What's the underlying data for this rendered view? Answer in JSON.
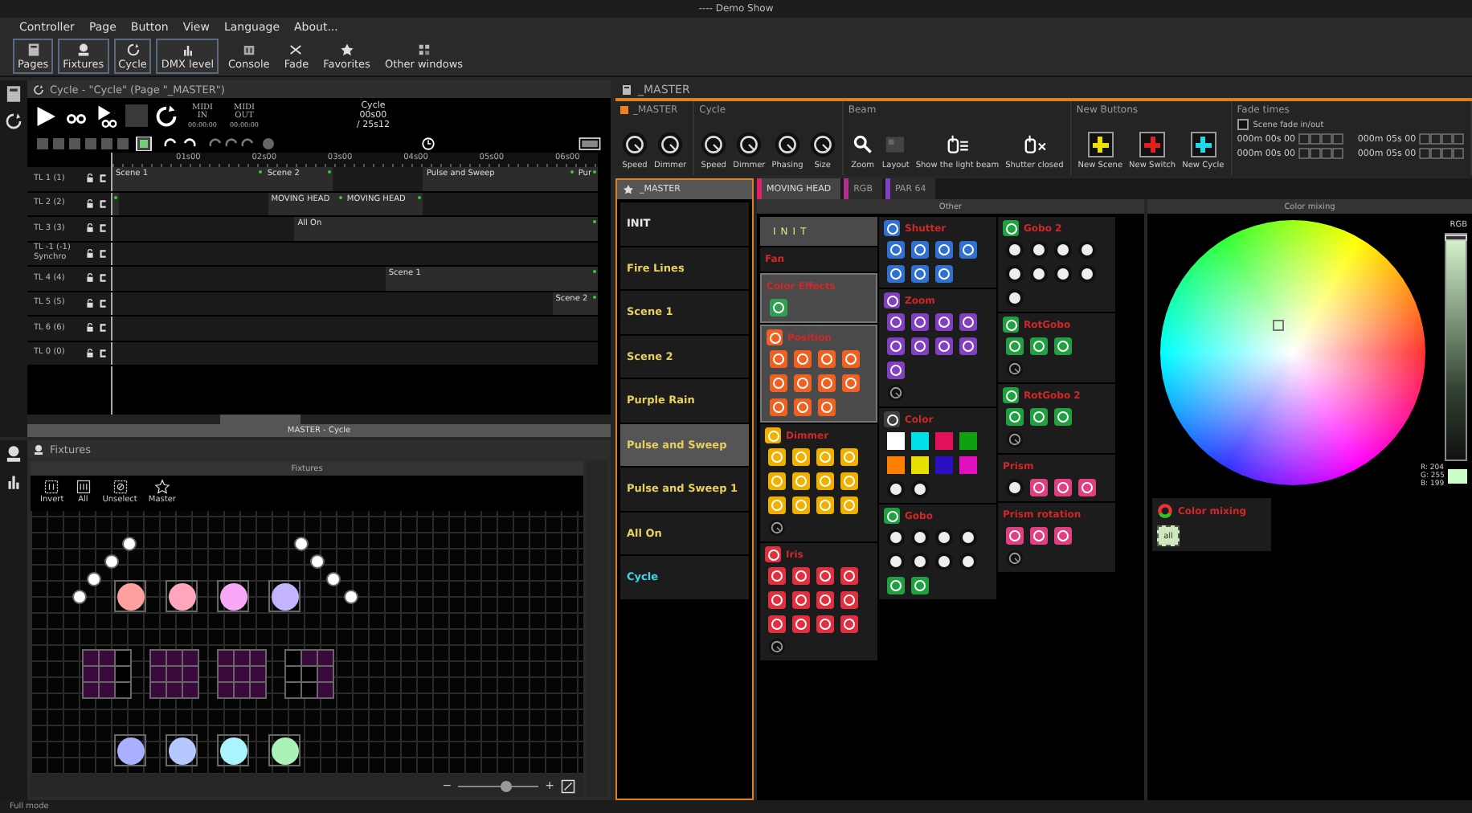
{
  "window": {
    "title": "---- Demo Show"
  },
  "menu": [
    "Controller",
    "Page",
    "Button",
    "View",
    "Language",
    "About..."
  ],
  "toolbar": [
    {
      "label": "Pages",
      "kind": "pages",
      "on": true
    },
    {
      "label": "Fixtures",
      "kind": "fixtures",
      "on": true
    },
    {
      "label": "Cycle",
      "kind": "cycle",
      "on": true
    },
    {
      "label": "DMX level",
      "kind": "levels",
      "on": true
    },
    {
      "label": "Console",
      "kind": "console",
      "on": false
    },
    {
      "label": "Fade",
      "kind": "fade",
      "on": false
    },
    {
      "label": "Favorites",
      "kind": "favorites",
      "on": false
    },
    {
      "label": "Other windows",
      "kind": "windows",
      "on": false
    }
  ],
  "cycle_window": {
    "title": "Cycle - \"Cycle\" (Page \"_MASTER\")",
    "midi": [
      {
        "label": "MIDI IN",
        "time": "00:00:00"
      },
      {
        "label": "MIDI OUT",
        "time": "00:00:00"
      }
    ],
    "clock": {
      "label": "Cycle",
      "time": "00s00",
      "total": "/ 25s12"
    },
    "ruler": [
      "01s00",
      "02s00",
      "03s00",
      "04s00",
      "05s00",
      "06s00"
    ],
    "tracks": [
      {
        "label": "TL 1 (1)",
        "clips": [
          {
            "kind": "clip",
            "label": "Scene 1"
          },
          {
            "kind": "clip",
            "label": "Scene 2"
          },
          {
            "kind": "clip",
            "label": "Pulse and Sweep"
          },
          {
            "kind": "clip",
            "label": "Pur"
          }
        ]
      },
      {
        "label": "TL 2 (2)",
        "clips": [
          {
            "kind": "start"
          },
          {
            "kind": "clip",
            "label": "MOVING HEAD"
          },
          {
            "kind": "clip",
            "label": "MOVING HEAD"
          }
        ]
      },
      {
        "label": "TL 3 (3)",
        "clips": [
          {
            "kind": "clip",
            "label": "All On"
          }
        ]
      },
      {
        "label": "TL -1 (-1) Synchro"
      },
      {
        "label": "TL 4 (4)",
        "clips": [
          {
            "kind": "clip",
            "label": "Scene 1"
          }
        ]
      },
      {
        "label": "TL 5 (5)",
        "clips": [
          {
            "kind": "clip",
            "label": "Scene 2"
          }
        ]
      },
      {
        "label": "TL 6 (6)"
      },
      {
        "label": "TL 0 (0)"
      }
    ],
    "footer": "MASTER - Cycle"
  },
  "fixtures_window": {
    "title": "Fixtures",
    "panel_title": "Fixtures",
    "tools": [
      {
        "label": "Invert",
        "kind": "invert"
      },
      {
        "label": "All",
        "kind": "all"
      },
      {
        "label": "Unselect",
        "kind": "unselect"
      },
      {
        "label": "Master",
        "kind": "master"
      }
    ],
    "lamps": [
      {
        "color": "#ffa0a0"
      },
      {
        "color": "#ffa6bd"
      },
      {
        "color": "#f7a9f7"
      },
      {
        "color": "#c4b3ff"
      },
      {
        "color": "#aab0ff"
      },
      {
        "color": "#b4c8ff"
      },
      {
        "color": "#aaf4ff"
      },
      {
        "color": "#aaf2b8"
      }
    ],
    "matrices": [
      {
        "cells": [
          true,
          true,
          false,
          true,
          true,
          false,
          true,
          true,
          false
        ]
      },
      {
        "cells": [
          true,
          true,
          true,
          true,
          true,
          true,
          true,
          true,
          true
        ]
      },
      {
        "cells": [
          true,
          true,
          true,
          true,
          true,
          true,
          true,
          true,
          true
        ]
      },
      {
        "cells": [
          false,
          true,
          true,
          false,
          false,
          true,
          false,
          false,
          true
        ]
      }
    ],
    "zoom": {
      "minus": "−",
      "plus": "+",
      "level": 0.6
    }
  },
  "master_window": {
    "title": "_MASTER",
    "groups": [
      {
        "title": "_MASTER",
        "controls": [
          {
            "kind": "knob",
            "label": "Speed"
          },
          {
            "kind": "knob",
            "label": "Dimmer"
          }
        ]
      },
      {
        "title": "Cycle",
        "controls": [
          {
            "kind": "knob",
            "label": "Speed"
          },
          {
            "kind": "knob",
            "label": "Dimmer"
          },
          {
            "kind": "knob",
            "label": "Phasing"
          },
          {
            "kind": "knob",
            "label": "Size"
          }
        ]
      },
      {
        "title": "Beam",
        "controls": [
          {
            "kind": "zoom",
            "label": "Zoom"
          },
          {
            "kind": "layout",
            "label": "Layout"
          },
          {
            "kind": "beam",
            "label": "Show the light beam"
          },
          {
            "kind": "shutter",
            "label": "Shutter closed"
          }
        ]
      },
      {
        "title": "New Buttons",
        "controls": [
          {
            "kind": "add",
            "label": "New Scene",
            "color": "#f0e000"
          },
          {
            "kind": "add",
            "label": "New Switch",
            "color": "#e02020"
          },
          {
            "kind": "add",
            "label": "New Cycle",
            "color": "#20d8e8"
          }
        ]
      }
    ],
    "fade_times": {
      "title": "Fade times",
      "checkbox": {
        "label": "Scene fade in/out",
        "checked": false
      },
      "times": [
        "000m 00s 00",
        "000m 05s 00",
        "000m 00s 00",
        "000m 05s 00"
      ]
    },
    "pages": {
      "tab": "_MASTER",
      "items": [
        {
          "label": "INIT",
          "color": "#e8e8e8",
          "selected": false
        },
        {
          "label": "Fire Lines",
          "color": "#e8d060",
          "selected": false
        },
        {
          "label": "Scene 1",
          "color": "#e8d060",
          "selected": false
        },
        {
          "label": "Scene 2",
          "color": "#e8d060",
          "selected": false
        },
        {
          "label": "Purple Rain",
          "color": "#e8d060",
          "selected": false
        },
        {
          "label": "Pulse and Sweep",
          "color": "#e8d060",
          "selected": true
        },
        {
          "label": "Pulse and Sweep 1",
          "color": "#e8d060",
          "selected": false
        },
        {
          "label": "All On",
          "color": "#e8d060",
          "selected": false
        },
        {
          "label": "Cycle",
          "color": "#40d8e8",
          "selected": false
        }
      ]
    },
    "fixture_tabs": [
      {
        "label": "MOVING HEAD",
        "color": "#e0206a",
        "selected": true
      },
      {
        "label": "RGB",
        "color": "#b03090",
        "selected": false
      },
      {
        "label": "PAR 64",
        "color": "#8040c0",
        "selected": false
      }
    ],
    "other": {
      "title": "Other",
      "columns": [
        [
          {
            "kind": "banner",
            "title": "INIT"
          },
          {
            "kind": "group",
            "title": "Fan",
            "selected": false,
            "icon": false
          },
          {
            "kind": "group",
            "title": "Color Effects",
            "selected": true,
            "icon": false,
            "color": "#30a050",
            "presets": [
              {
                "kind": "tile"
              }
            ]
          },
          {
            "kind": "group",
            "title": "Position",
            "selected": true,
            "icon": true,
            "color": "#f06020",
            "presets": [
              {
                "kind": "tile"
              },
              {
                "kind": "tile"
              },
              {
                "kind": "tile"
              },
              {
                "kind": "tile"
              },
              {
                "kind": "tile"
              },
              {
                "kind": "tile"
              },
              {
                "kind": "tile"
              },
              {
                "kind": "tile"
              },
              {
                "kind": "tile"
              },
              {
                "kind": "tile"
              },
              {
                "kind": "tile"
              }
            ]
          },
          {
            "kind": "group",
            "title": "Dimmer",
            "selected": false,
            "icon": true,
            "color": "#f0b000",
            "presets": [
              {
                "kind": "tile"
              },
              {
                "kind": "tile"
              },
              {
                "kind": "tile"
              },
              {
                "kind": "tile"
              },
              {
                "kind": "tile"
              },
              {
                "kind": "tile"
              },
              {
                "kind": "tile"
              },
              {
                "kind": "tile"
              },
              {
                "kind": "tile"
              },
              {
                "kind": "tile"
              },
              {
                "kind": "tile"
              },
              {
                "kind": "tile"
              }
            ],
            "knob": true
          },
          {
            "kind": "group",
            "title": "Iris",
            "selected": false,
            "icon": true,
            "color": "#e03040",
            "presets": [
              {
                "kind": "tile"
              },
              {
                "kind": "tile"
              },
              {
                "kind": "tile"
              },
              {
                "kind": "tile"
              },
              {
                "kind": "tile"
              },
              {
                "kind": "tile"
              },
              {
                "kind": "tile"
              },
              {
                "kind": "tile"
              },
              {
                "kind": "tile"
              },
              {
                "kind": "tile"
              },
              {
                "kind": "tile"
              },
              {
                "kind": "tile"
              }
            ],
            "knob": true
          }
        ],
        [
          {
            "kind": "group",
            "title": "Shutter",
            "selected": false,
            "icon": true,
            "color": "#3070d0",
            "presets": [
              {
                "kind": "tile"
              },
              {
                "kind": "tile"
              },
              {
                "kind": "tile"
              },
              {
                "kind": "tile"
              },
              {
                "kind": "tile"
              },
              {
                "kind": "tile"
              },
              {
                "kind": "tile"
              }
            ]
          },
          {
            "kind": "group",
            "title": "Zoom",
            "selected": false,
            "icon": true,
            "color": "#8040c0",
            "presets": [
              {
                "kind": "tile"
              },
              {
                "kind": "tile"
              },
              {
                "kind": "tile"
              },
              {
                "kind": "tile"
              },
              {
                "kind": "tile"
              },
              {
                "kind": "tile"
              },
              {
                "kind": "tile"
              },
              {
                "kind": "tile"
              },
              {
                "kind": "tile"
              }
            ],
            "knob": true
          },
          {
            "kind": "group",
            "title": "Color",
            "selected": false,
            "icon": true,
            "color": "#404040",
            "presets": [
              {
                "kind": "swatch",
                "color": "#ffffff"
              },
              {
                "kind": "swatch",
                "color": "#00e0e8"
              },
              {
                "kind": "swatch",
                "color": "#e0105a"
              },
              {
                "kind": "swatch",
                "color": "#10a010"
              },
              {
                "kind": "swatch",
                "color": "#ff8000"
              },
              {
                "kind": "swatch",
                "color": "#e8e000"
              },
              {
                "kind": "swatch",
                "color": "#2a10c0"
              },
              {
                "kind": "swatch",
                "color": "#e010c0"
              },
              {
                "kind": "glyph"
              },
              {
                "kind": "glyph"
              }
            ]
          },
          {
            "kind": "group",
            "title": "Gobo",
            "selected": false,
            "icon": true,
            "color": "#20a040",
            "presets": [
              {
                "kind": "glyph"
              },
              {
                "kind": "glyph"
              },
              {
                "kind": "glyph"
              },
              {
                "kind": "glyph"
              },
              {
                "kind": "glyph"
              },
              {
                "kind": "glyph"
              },
              {
                "kind": "glyph"
              },
              {
                "kind": "glyph"
              },
              {
                "kind": "tile"
              },
              {
                "kind": "tile"
              }
            ]
          }
        ],
        [
          {
            "kind": "group",
            "title": "Gobo 2",
            "selected": false,
            "icon": true,
            "color": "#20a040",
            "presets": [
              {
                "kind": "glyph"
              },
              {
                "kind": "glyph"
              },
              {
                "kind": "glyph"
              },
              {
                "kind": "glyph"
              },
              {
                "kind": "glyph"
              },
              {
                "kind": "glyph"
              },
              {
                "kind": "glyph"
              },
              {
                "kind": "glyph"
              },
              {
                "kind": "glyph"
              }
            ]
          },
          {
            "kind": "group",
            "title": "RotGobo",
            "selected": false,
            "icon": true,
            "color": "#20a040",
            "presets": [
              {
                "kind": "tile"
              },
              {
                "kind": "tile"
              },
              {
                "kind": "tile"
              }
            ],
            "knob": true
          },
          {
            "kind": "group",
            "title": "RotGobo 2",
            "selected": false,
            "icon": true,
            "color": "#20a040",
            "presets": [
              {
                "kind": "tile"
              },
              {
                "kind": "tile"
              },
              {
                "kind": "tile"
              }
            ],
            "knob": true
          },
          {
            "kind": "group",
            "title": "Prism",
            "selected": false,
            "icon": false,
            "color": "#e04080",
            "presets": [
              {
                "kind": "glyph"
              },
              {
                "kind": "tile"
              },
              {
                "kind": "tile"
              },
              {
                "kind": "tile"
              }
            ]
          },
          {
            "kind": "group",
            "title": "Prism rotation",
            "selected": false,
            "icon": false,
            "color": "#e04080",
            "presets": [
              {
                "kind": "tile"
              },
              {
                "kind": "tile"
              },
              {
                "kind": "tile"
              }
            ],
            "knob": true
          }
        ]
      ]
    },
    "color_mixing": {
      "title": "Color mixing",
      "slider_label": "RGB",
      "level": 0.97,
      "readings": [
        "R: 204",
        "G: 255",
        "B: 199"
      ],
      "color": "#ccffc7",
      "group": {
        "title": "Color mixing",
        "preset": "all"
      }
    }
  },
  "status_bar": "Full mode"
}
